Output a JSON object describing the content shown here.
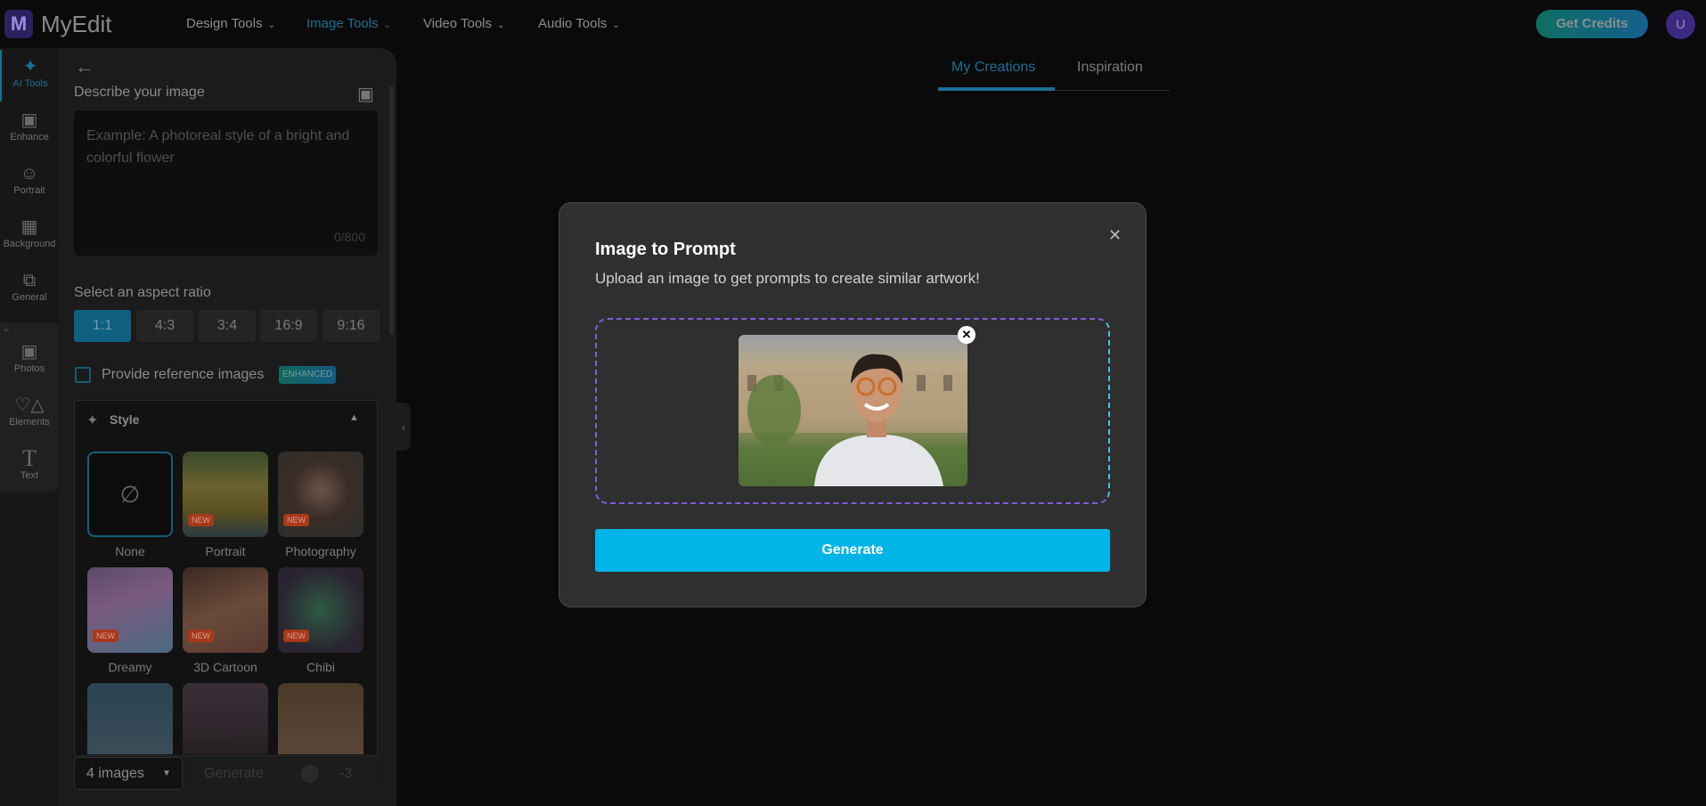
{
  "header": {
    "logo_text": "MyEdit",
    "logo_letter": "M",
    "nav": [
      {
        "label": "Design Tools"
      },
      {
        "label": "Image Tools",
        "active": true
      },
      {
        "label": "Video Tools"
      },
      {
        "label": "Audio Tools"
      }
    ],
    "get_credits": "Get Credits",
    "avatar": "U"
  },
  "rail": {
    "items": [
      {
        "label": "AI Tools",
        "icon": "magic-wand-icon"
      },
      {
        "label": "Enhance",
        "icon": "image-sparkle-icon"
      },
      {
        "label": "Portrait",
        "icon": "portrait-icon"
      },
      {
        "label": "Background",
        "icon": "background-icon"
      },
      {
        "label": "General",
        "icon": "layers-icon"
      },
      {
        "label": "Photos",
        "icon": "photo-icon"
      },
      {
        "label": "Elements",
        "icon": "shapes-icon"
      },
      {
        "label": "Text",
        "icon": "text-icon"
      }
    ]
  },
  "panel": {
    "describe_label": "Describe your image",
    "prompt_placeholder": "Example: A photoreal style of a bright and colorful flower",
    "counter": "0/800",
    "aspect_label": "Select an aspect ratio",
    "ratios": [
      "1:1",
      "4:3",
      "3:4",
      "16:9",
      "9:16"
    ],
    "selected_ratio": "1:1",
    "reference_label": "Provide reference images",
    "reference_badge": "ENHANCED",
    "style_title": "Style",
    "styles": [
      {
        "label": "None"
      },
      {
        "label": "Portrait",
        "badge": "NEW"
      },
      {
        "label": "Photography",
        "badge": "NEW"
      },
      {
        "label": "Dreamy",
        "badge": "NEW"
      },
      {
        "label": "3D Cartoon",
        "badge": "NEW"
      },
      {
        "label": "Chibi",
        "badge": "NEW"
      }
    ],
    "count_select": "4 images",
    "generate": "Generate",
    "cost": "-3"
  },
  "tabs": [
    {
      "label": "My Creations",
      "active": true
    },
    {
      "label": "Inspiration"
    }
  ],
  "modal": {
    "title": "Image to Prompt",
    "subtitle": "Upload an image to get prompts to create similar artwork!",
    "generate": "Generate"
  },
  "colors": {
    "accent": "#00b4e8",
    "dim_accent": "#1b6f93"
  }
}
